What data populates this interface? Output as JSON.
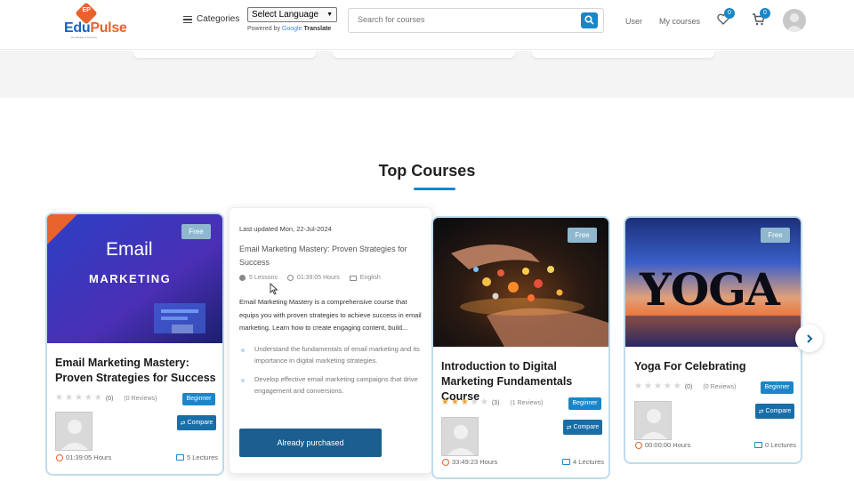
{
  "header": {
    "logo": {
      "name_part1": "Edu",
      "name_part2": "Pulse",
      "mark": "EP",
      "tagline": "knowledge & learning"
    },
    "categories_label": "Categories",
    "language_select": {
      "selected": "Select Language"
    },
    "powered_by": {
      "prefix": "Powered by",
      "brand": "Google",
      "product": "Translate"
    },
    "search": {
      "placeholder": "Search for courses"
    },
    "nav": {
      "user": "User",
      "my_courses": "My courses"
    },
    "wishlist_count": "0",
    "cart_count": "0"
  },
  "section": {
    "title": "Top Courses"
  },
  "courses": [
    {
      "image_text_line1": "Email",
      "image_text_line2": "MARKETING",
      "badge": "Free",
      "title": "Email Marketing Mastery: Proven Strategies for Success",
      "rating": "(0)",
      "reviews": "(0 Reviews)",
      "level": "Beginner",
      "compare": "Compare",
      "duration": "01:39:05 Hours",
      "lectures": "5 Lectures"
    },
    {
      "badge": "Free",
      "title": "Introduction to Digital Marketing Fundamentals Course",
      "rating": "(3)",
      "reviews": "(1 Reviews)",
      "stars_filled": 3,
      "level": "Beginner",
      "compare": "Compare",
      "duration": "33:49:23 Hours",
      "lectures": "4 Lectures"
    },
    {
      "image_text": "YOGA",
      "badge": "Free",
      "title": "Yoga For Celebrating",
      "rating": "(0)",
      "reviews": "(0 Reviews)",
      "level": "Beginner",
      "compare": "Compare",
      "duration": "00:00:00 Hours",
      "lectures": "0 Lectures"
    }
  ],
  "hover_card": {
    "updated": "Last updated Mon, 22-Jul-2024",
    "title": "Email Marketing Mastery: Proven Strategies for Success",
    "lessons": "5 Lessons",
    "duration": "01:39:05 Hours",
    "language": "English",
    "description": "Email Marketing Mastery is a comprehensive course that equips you with proven strategies to achieve success in email marketing. Learn how to create engaging content, build...",
    "outcomes": [
      "Understand the fundamentals of email marketing and its importance in digital marketing strategies.",
      "Develop effective email marketing campaigns that drive engagement and conversions."
    ],
    "button": "Already purchased"
  },
  "colors": {
    "accent": "#1a86c8",
    "brand_orange": "#e8622c",
    "button_dark": "#1a5f8f"
  }
}
